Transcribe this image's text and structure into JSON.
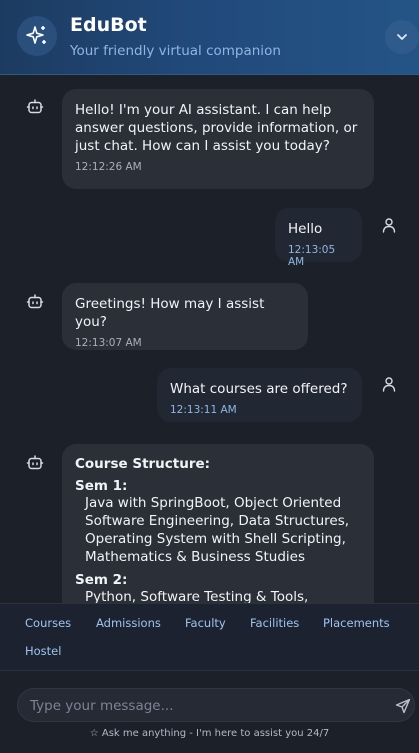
{
  "header": {
    "title": "EduBot",
    "subtitle": "Your friendly virtual companion",
    "icon": "sparkles-icon",
    "collapse_icon": "chevron-down-icon"
  },
  "messages": [
    {
      "sender": "bot",
      "text": "Hello! I'm your AI assistant. I can help answer questions, provide information, or just chat. How can I assist you today?",
      "time": "12:12:26 AM"
    },
    {
      "sender": "user",
      "text": "Hello",
      "time": "12:13:05 AM"
    },
    {
      "sender": "bot",
      "text": "Greetings! How may I assist you?",
      "time": "12:13:07 AM"
    },
    {
      "sender": "user",
      "text": "What courses are offered?",
      "time": "12:13:11 AM"
    },
    {
      "sender": "bot",
      "title": "Course Structure:",
      "sections": [
        {
          "heading": "Sem 1:",
          "body": "Java with SpringBoot, Object Oriented Software Engineering, Data Structures, Operating System with Shell Scripting, Mathematics & Business Studies"
        },
        {
          "heading": "Sem 2:",
          "body": "Python, Software Testing & Tools, ADBMS"
        }
      ]
    }
  ],
  "quick_replies": [
    "Courses",
    "Admissions",
    "Faculty",
    "Facilities",
    "Placements",
    "Hostel"
  ],
  "input": {
    "placeholder": "Type your message...",
    "value": ""
  },
  "footer_note": "☆ Ask me anything - I'm here to assist you 24/7",
  "colors": {
    "header_start": "#1c3b60",
    "header_end": "#245487",
    "accent": "#8fb6e2",
    "background": "#1b2029"
  }
}
